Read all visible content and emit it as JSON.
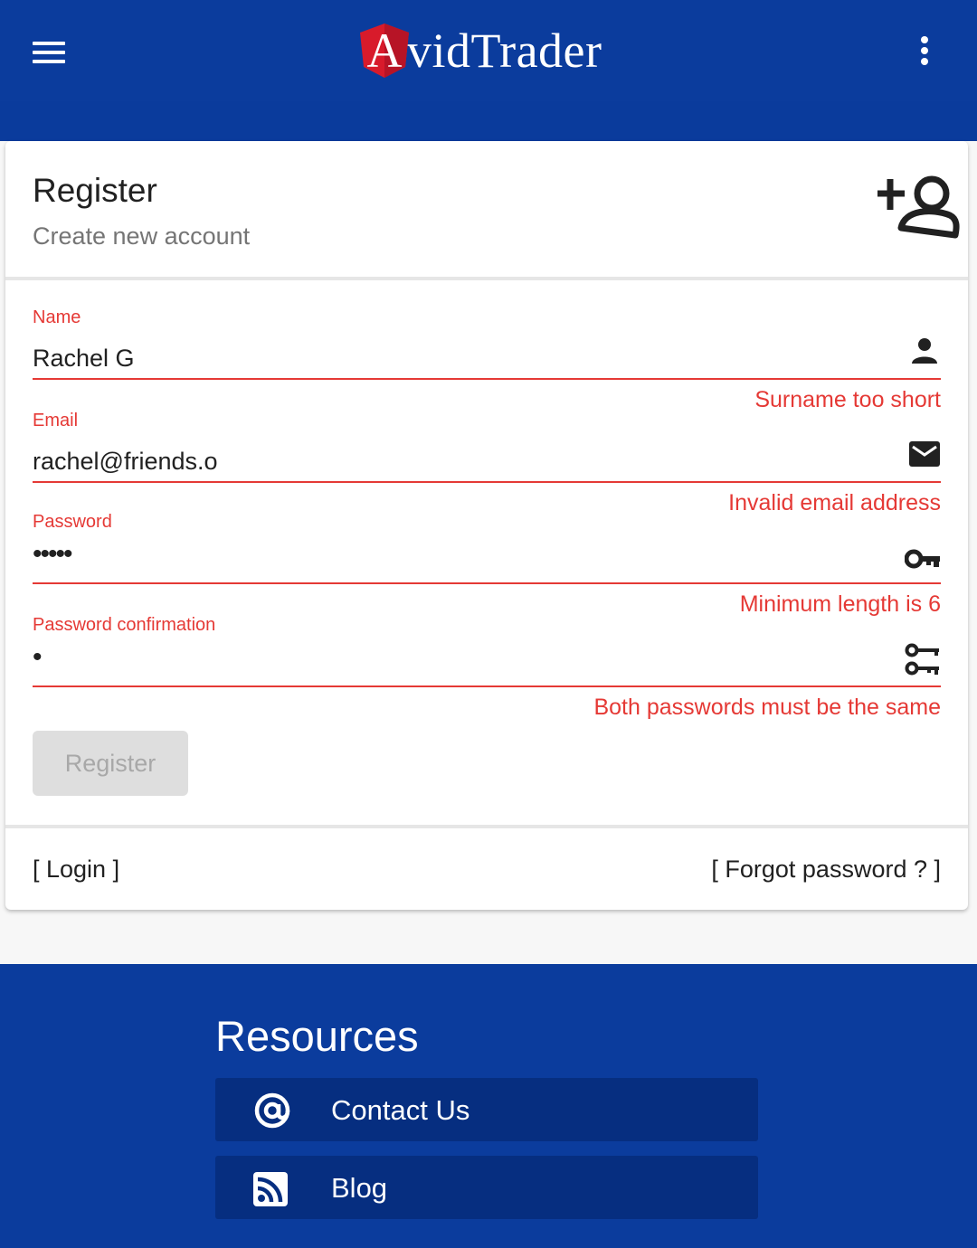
{
  "app": {
    "logo_letter": "A",
    "logo_rest": "vidTrader",
    "colors": {
      "primary": "#0b3c9d",
      "error": "#e53935",
      "logo_red": "#d81b2b"
    }
  },
  "card": {
    "title": "Register",
    "subtitle": "Create new account",
    "header_icon": "person-add-icon"
  },
  "form": {
    "fields": [
      {
        "label": "Name",
        "value": "Rachel G",
        "icon": "person-icon",
        "error": "Surname too short"
      },
      {
        "label": "Email",
        "value": "rachel@friends.o",
        "icon": "mail-icon",
        "error": "Invalid email address"
      },
      {
        "label": "Password",
        "value": "•••••",
        "icon": "key-icon",
        "error": "Minimum length is 6"
      },
      {
        "label": "Password confirmation",
        "value": "•",
        "icon": "key-double-icon",
        "error": "Both passwords must be the same"
      }
    ],
    "submit_label": "Register"
  },
  "links": {
    "login": "[ Login ]",
    "forgot": "[ Forgot password ? ]"
  },
  "footer": {
    "title": "Resources",
    "items": [
      {
        "label": "Contact Us",
        "icon": "at-sign-icon"
      },
      {
        "label": "Blog",
        "icon": "rss-icon"
      }
    ]
  }
}
